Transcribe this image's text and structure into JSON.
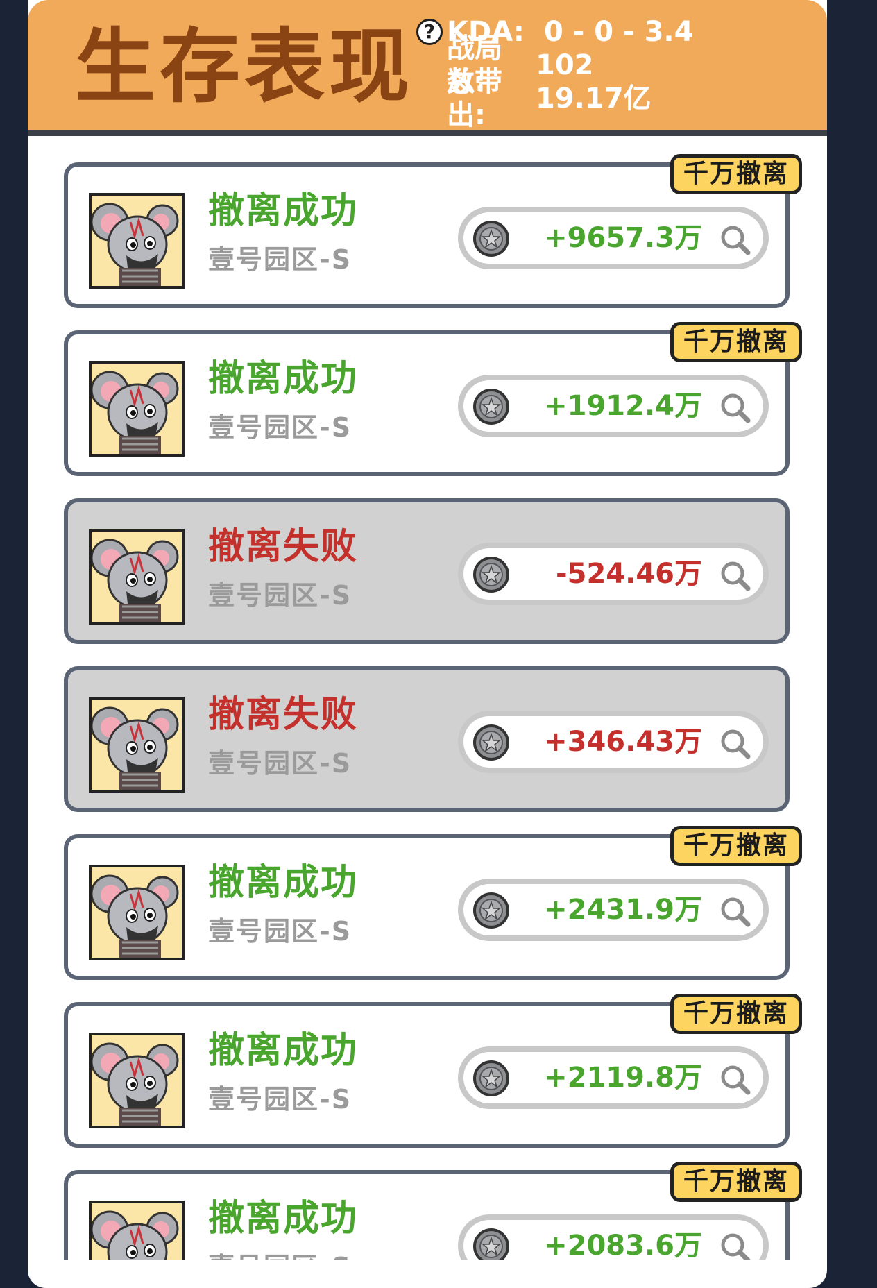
{
  "header": {
    "title": "生存表现",
    "stats": {
      "kda_label": "KDA:",
      "kda_value": "0 - 0 - 3.4",
      "matches_label": "战局数:",
      "matches_value": "102",
      "total_label": "总带出:",
      "total_value": "19.17亿"
    }
  },
  "records": [
    {
      "status": "撤离成功",
      "state": "success",
      "zone": "壹号园区-S",
      "value": "+9657.3万",
      "tag": "千万撤离"
    },
    {
      "status": "撤离成功",
      "state": "success",
      "zone": "壹号园区-S",
      "value": "+1912.4万",
      "tag": "千万撤离"
    },
    {
      "status": "撤离失败",
      "state": "fail",
      "zone": "壹号园区-S",
      "value": "-524.46万",
      "tag": ""
    },
    {
      "status": "撤离失败",
      "state": "fail",
      "zone": "壹号园区-S",
      "value": "+346.43万",
      "tag": ""
    },
    {
      "status": "撤离成功",
      "state": "success",
      "zone": "壹号园区-S",
      "value": "+2431.9万",
      "tag": "千万撤离"
    },
    {
      "status": "撤离成功",
      "state": "success",
      "zone": "壹号园区-S",
      "value": "+2119.8万",
      "tag": "千万撤离"
    },
    {
      "status": "撤离成功",
      "state": "success",
      "zone": "壹号园区-S",
      "value": "+2083.6万",
      "tag": "千万撤离"
    }
  ],
  "icons": {
    "help": "question-circle-icon",
    "coin": "coin-icon",
    "search": "magnifier-icon",
    "avatar": "mouse-avatar"
  },
  "colors": {
    "header_bg": "#f1aa5a",
    "title": "#8a4312",
    "success": "#49a52d",
    "fail": "#c4302b",
    "tag_bg": "#fcd45f",
    "fail_card_bg": "#d1d1d1"
  }
}
